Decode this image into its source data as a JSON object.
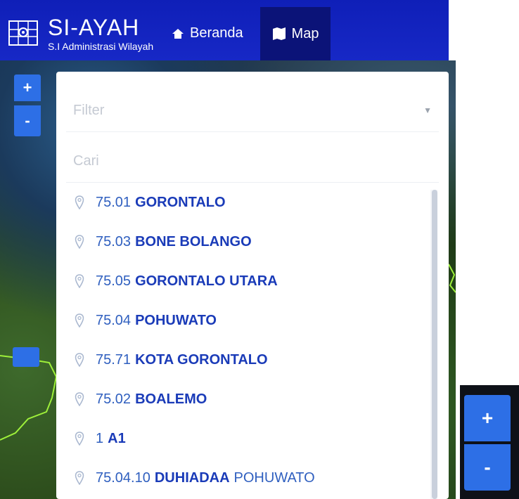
{
  "app": {
    "title": "SI-AYAH",
    "subtitle": "S.I Administrasi Wilayah",
    "logo_icon": "map-grid-icon"
  },
  "nav": {
    "home_label": "Beranda",
    "home_icon": "home-icon",
    "map_label": "Map",
    "map_icon": "map-icon"
  },
  "map_controls": {
    "zoom_in": "+",
    "zoom_out": "-"
  },
  "panel": {
    "filter_placeholder": "Filter",
    "search_placeholder": "Cari",
    "items": [
      {
        "code": "75.01",
        "name": "GORONTALO",
        "extra": ""
      },
      {
        "code": "75.03",
        "name": "BONE BOLANGO",
        "extra": ""
      },
      {
        "code": "75.05",
        "name": "GORONTALO UTARA",
        "extra": ""
      },
      {
        "code": "75.04",
        "name": "POHUWATO",
        "extra": ""
      },
      {
        "code": "75.71",
        "name": "KOTA GORONTALO",
        "extra": ""
      },
      {
        "code": "75.02",
        "name": "BOALEMO",
        "extra": ""
      },
      {
        "code": "1",
        "name": "A1",
        "extra": ""
      },
      {
        "code": "75.04.10",
        "name": "DUHIADAA",
        "extra": "POHUWATO"
      }
    ]
  },
  "colors": {
    "navbar": "#1728c6",
    "nav_active": "#0b1378",
    "button": "#2d6fe6",
    "item_name": "#1a3bb8",
    "item_code": "#2f5fbf"
  }
}
